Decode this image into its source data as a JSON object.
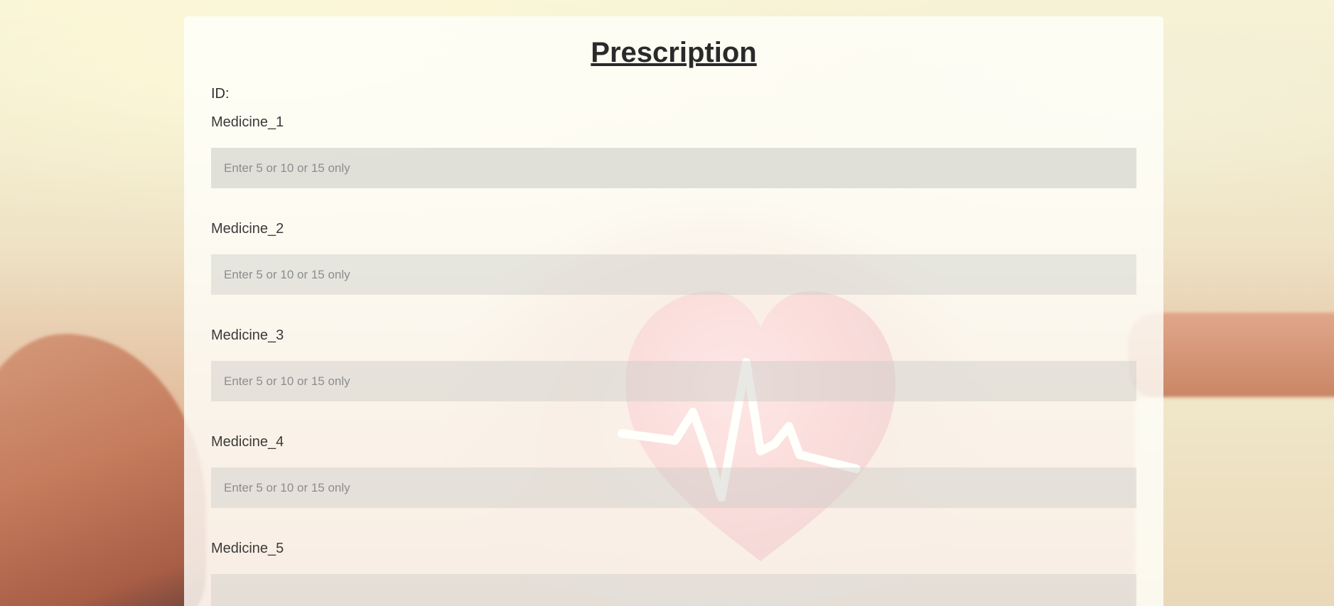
{
  "page": {
    "title": "Prescription",
    "id_label": "ID:"
  },
  "fields": [
    {
      "label": "Medicine_1",
      "placeholder": "Enter 5 or 10 or 15 only",
      "value": ""
    },
    {
      "label": "Medicine_2",
      "placeholder": "Enter 5 or 10 or 15 only",
      "value": ""
    },
    {
      "label": "Medicine_3",
      "placeholder": "Enter 5 or 10 or 15 only",
      "value": ""
    },
    {
      "label": "Medicine_4",
      "placeholder": "Enter 5 or 10 or 15 only",
      "value": ""
    },
    {
      "label": "Medicine_5",
      "placeholder": "",
      "value": ""
    }
  ],
  "colors": {
    "card_background": "#fffffa",
    "input_background": "#cdcdc8",
    "text": "#2a2a2a",
    "heart": "#e8454f"
  }
}
